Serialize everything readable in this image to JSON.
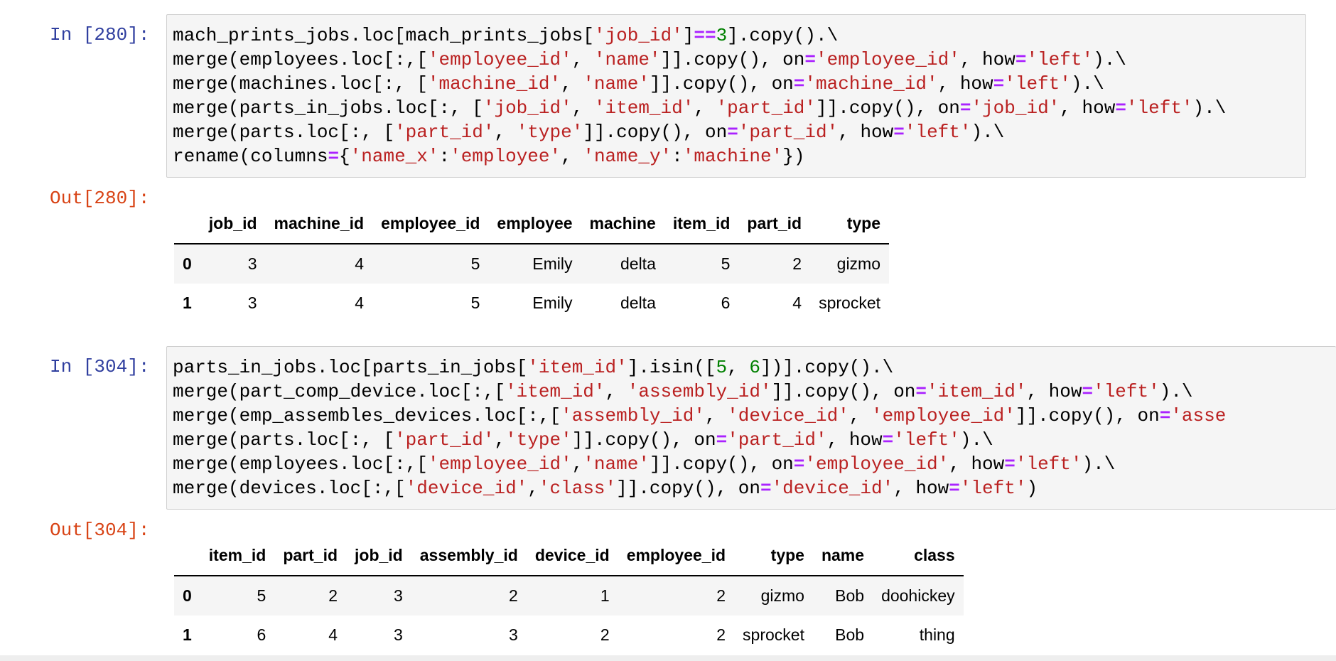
{
  "cells": [
    {
      "in_prompt": "In [280]:",
      "out_prompt": "Out[280]:",
      "code": [
        [
          [
            "mach_prints_jobs.loc[mach_prints_jobs[",
            ""
          ],
          [
            "'job_id'",
            "s"
          ],
          [
            "]",
            ""
          ],
          [
            "==",
            "o"
          ],
          [
            "3",
            "n"
          ],
          [
            "].copy().\\",
            ""
          ]
        ],
        [
          [
            "merge(employees.loc[:,[",
            ""
          ],
          [
            "'employee_id'",
            "s"
          ],
          [
            ", ",
            ""
          ],
          [
            "'name'",
            "s"
          ],
          [
            "]].copy(), on",
            ""
          ],
          [
            "=",
            "o"
          ],
          [
            "'employee_id'",
            "s"
          ],
          [
            ", how",
            ""
          ],
          [
            "=",
            "o"
          ],
          [
            "'left'",
            "s"
          ],
          [
            ").\\",
            ""
          ]
        ],
        [
          [
            "merge(machines.loc[:, [",
            ""
          ],
          [
            "'machine_id'",
            "s"
          ],
          [
            ", ",
            ""
          ],
          [
            "'name'",
            "s"
          ],
          [
            "]].copy(), on",
            ""
          ],
          [
            "=",
            "o"
          ],
          [
            "'machine_id'",
            "s"
          ],
          [
            ", how",
            ""
          ],
          [
            "=",
            "o"
          ],
          [
            "'left'",
            "s"
          ],
          [
            ").\\",
            ""
          ]
        ],
        [
          [
            "merge(parts_in_jobs.loc[:, [",
            ""
          ],
          [
            "'job_id'",
            "s"
          ],
          [
            ", ",
            ""
          ],
          [
            "'item_id'",
            "s"
          ],
          [
            ", ",
            ""
          ],
          [
            "'part_id'",
            "s"
          ],
          [
            "]].copy(), on",
            ""
          ],
          [
            "=",
            "o"
          ],
          [
            "'job_id'",
            "s"
          ],
          [
            ", how",
            ""
          ],
          [
            "=",
            "o"
          ],
          [
            "'left'",
            "s"
          ],
          [
            ").\\",
            ""
          ]
        ],
        [
          [
            "merge(parts.loc[:, [",
            ""
          ],
          [
            "'part_id'",
            "s"
          ],
          [
            ", ",
            ""
          ],
          [
            "'type'",
            "s"
          ],
          [
            "]].copy(), on",
            ""
          ],
          [
            "=",
            "o"
          ],
          [
            "'part_id'",
            "s"
          ],
          [
            ", how",
            ""
          ],
          [
            "=",
            "o"
          ],
          [
            "'left'",
            "s"
          ],
          [
            ").\\",
            ""
          ]
        ],
        [
          [
            "rename(columns",
            ""
          ],
          [
            "=",
            "o"
          ],
          [
            "{",
            ""
          ],
          [
            "'name_x'",
            "s"
          ],
          [
            ":",
            ""
          ],
          [
            "'employee'",
            "s"
          ],
          [
            ", ",
            ""
          ],
          [
            "'name_y'",
            "s"
          ],
          [
            ":",
            ""
          ],
          [
            "'machine'",
            "s"
          ],
          [
            "})",
            ""
          ]
        ]
      ],
      "table": {
        "columns": [
          "",
          "job_id",
          "machine_id",
          "employee_id",
          "employee",
          "machine",
          "item_id",
          "part_id",
          "type"
        ],
        "rows": [
          [
            "0",
            "3",
            "4",
            "5",
            "Emily",
            "delta",
            "5",
            "2",
            "gizmo"
          ],
          [
            "1",
            "3",
            "4",
            "5",
            "Emily",
            "delta",
            "6",
            "4",
            "sprocket"
          ]
        ]
      }
    },
    {
      "in_prompt": "In [304]:",
      "out_prompt": "Out[304]:",
      "code": [
        [
          [
            "parts_in_jobs.loc[parts_in_jobs[",
            ""
          ],
          [
            "'item_id'",
            "s"
          ],
          [
            "].isin([",
            ""
          ],
          [
            "5",
            "n"
          ],
          [
            ", ",
            ""
          ],
          [
            "6",
            "n"
          ],
          [
            "])].copy().\\",
            ""
          ]
        ],
        [
          [
            "merge(part_comp_device.loc[:,[",
            ""
          ],
          [
            "'item_id'",
            "s"
          ],
          [
            ", ",
            ""
          ],
          [
            "'assembly_id'",
            "s"
          ],
          [
            "]].copy(), on",
            ""
          ],
          [
            "=",
            "o"
          ],
          [
            "'item_id'",
            "s"
          ],
          [
            ", how",
            ""
          ],
          [
            "=",
            "o"
          ],
          [
            "'left'",
            "s"
          ],
          [
            ").\\",
            ""
          ]
        ],
        [
          [
            "merge(emp_assembles_devices.loc[:,[",
            ""
          ],
          [
            "'assembly_id'",
            "s"
          ],
          [
            ", ",
            ""
          ],
          [
            "'device_id'",
            "s"
          ],
          [
            ", ",
            ""
          ],
          [
            "'employee_id'",
            "s"
          ],
          [
            "]].copy(), on",
            ""
          ],
          [
            "=",
            "o"
          ],
          [
            "'asse",
            "s"
          ]
        ],
        [
          [
            "merge(parts.loc[:, [",
            ""
          ],
          [
            "'part_id'",
            "s"
          ],
          [
            ",",
            ""
          ],
          [
            "'type'",
            "s"
          ],
          [
            "]].copy(), on",
            ""
          ],
          [
            "=",
            "o"
          ],
          [
            "'part_id'",
            "s"
          ],
          [
            ", how",
            ""
          ],
          [
            "=",
            "o"
          ],
          [
            "'left'",
            "s"
          ],
          [
            ").\\",
            ""
          ]
        ],
        [
          [
            "merge(employees.loc[:,[",
            ""
          ],
          [
            "'employee_id'",
            "s"
          ],
          [
            ",",
            ""
          ],
          [
            "'name'",
            "s"
          ],
          [
            "]].copy(), on",
            ""
          ],
          [
            "=",
            "o"
          ],
          [
            "'employee_id'",
            "s"
          ],
          [
            ", how",
            ""
          ],
          [
            "=",
            "o"
          ],
          [
            "'left'",
            "s"
          ],
          [
            ").\\",
            ""
          ]
        ],
        [
          [
            "merge(devices.loc[:,[",
            ""
          ],
          [
            "'device_id'",
            "s"
          ],
          [
            ",",
            ""
          ],
          [
            "'class'",
            "s"
          ],
          [
            "]].copy(), on",
            ""
          ],
          [
            "=",
            "o"
          ],
          [
            "'device_id'",
            "s"
          ],
          [
            ", how",
            ""
          ],
          [
            "=",
            "o"
          ],
          [
            "'left'",
            "s"
          ],
          [
            ")",
            ""
          ]
        ]
      ],
      "table": {
        "columns": [
          "",
          "item_id",
          "part_id",
          "job_id",
          "assembly_id",
          "device_id",
          "employee_id",
          "type",
          "name",
          "class"
        ],
        "rows": [
          [
            "0",
            "5",
            "2",
            "3",
            "2",
            "1",
            "2",
            "gizmo",
            "Bob",
            "doohickey"
          ],
          [
            "1",
            "6",
            "4",
            "3",
            "3",
            "2",
            "2",
            "sprocket",
            "Bob",
            "thing"
          ]
        ]
      }
    }
  ]
}
